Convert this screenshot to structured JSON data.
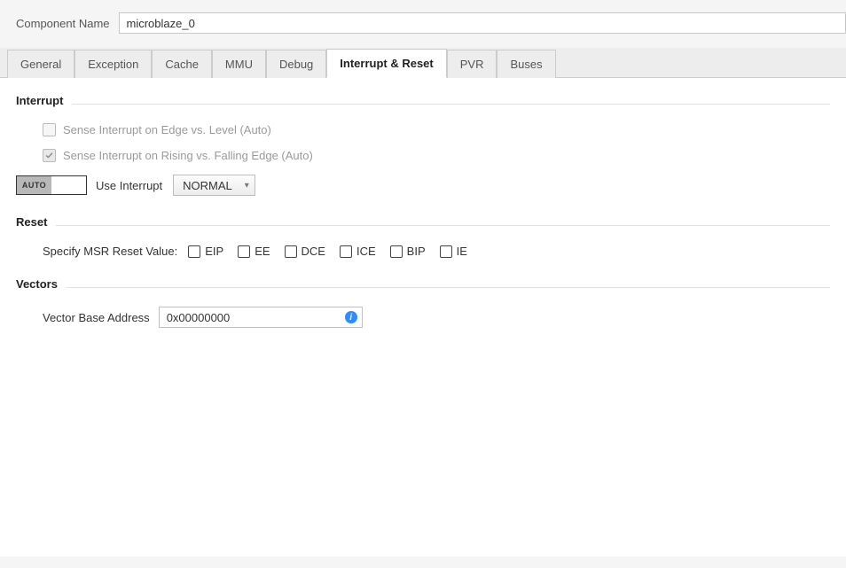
{
  "componentName": {
    "label": "Component Name",
    "value": "microblaze_0"
  },
  "tabs": [
    {
      "label": "General",
      "active": false
    },
    {
      "label": "Exception",
      "active": false
    },
    {
      "label": "Cache",
      "active": false
    },
    {
      "label": "MMU",
      "active": false
    },
    {
      "label": "Debug",
      "active": false
    },
    {
      "label": "Interrupt & Reset",
      "active": true
    },
    {
      "label": "PVR",
      "active": false
    },
    {
      "label": "Buses",
      "active": false
    }
  ],
  "interrupt": {
    "title": "Interrupt",
    "senseEdge": {
      "label": "Sense Interrupt on Edge vs. Level (Auto)",
      "checked": false,
      "disabled": true
    },
    "senseRising": {
      "label": "Sense Interrupt on Rising vs. Falling Edge (Auto)",
      "checked": true,
      "disabled": true
    },
    "autoBadge": "AUTO",
    "useLabel": "Use Interrupt",
    "useValue": "NORMAL"
  },
  "reset": {
    "title": "Reset",
    "label": "Specify MSR Reset Value:",
    "flags": [
      {
        "name": "EIP",
        "checked": false
      },
      {
        "name": "EE",
        "checked": false
      },
      {
        "name": "DCE",
        "checked": false
      },
      {
        "name": "ICE",
        "checked": false
      },
      {
        "name": "BIP",
        "checked": false
      },
      {
        "name": "IE",
        "checked": false
      }
    ]
  },
  "vectors": {
    "title": "Vectors",
    "label": "Vector Base Address",
    "value": "0x00000000"
  }
}
